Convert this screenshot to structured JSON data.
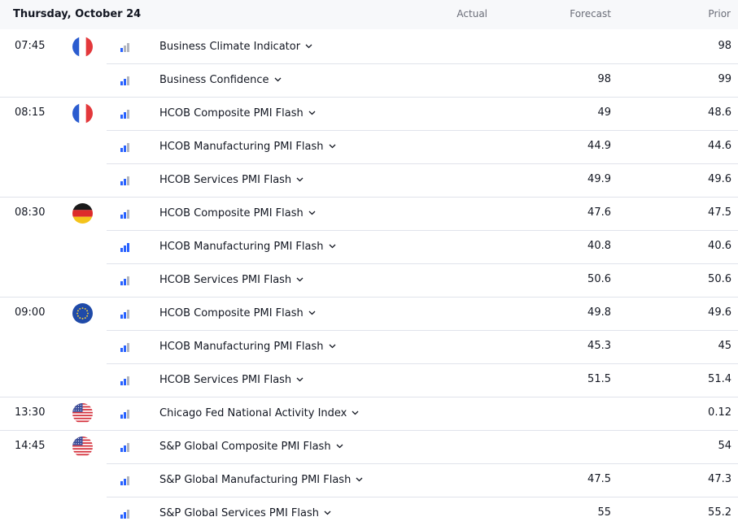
{
  "header": {
    "date": "Thursday, October 24",
    "actual_label": "Actual",
    "forecast_label": "Forecast",
    "prior_label": "Prior"
  },
  "colors": {
    "bar_active": "#2962ff",
    "bar_inactive": "#b2b5be"
  },
  "rows": [
    {
      "time": "07:45",
      "flag": "france-flag-icon",
      "importance": 1,
      "name": "Business Climate Indicator",
      "actual": "",
      "forecast": "",
      "prior": "98"
    },
    {
      "time": "",
      "flag": "",
      "importance": 2,
      "name": "Business Confidence",
      "actual": "",
      "forecast": "98",
      "prior": "99"
    },
    {
      "time": "08:15",
      "flag": "france-flag-icon",
      "importance": 2,
      "name": "HCOB Composite PMI Flash",
      "actual": "",
      "forecast": "49",
      "prior": "48.6"
    },
    {
      "time": "",
      "flag": "",
      "importance": 2,
      "name": "HCOB Manufacturing PMI Flash",
      "actual": "",
      "forecast": "44.9",
      "prior": "44.6"
    },
    {
      "time": "",
      "flag": "",
      "importance": 2,
      "name": "HCOB Services PMI Flash",
      "actual": "",
      "forecast": "49.9",
      "prior": "49.6"
    },
    {
      "time": "08:30",
      "flag": "germany-flag-icon",
      "importance": 2,
      "name": "HCOB Composite PMI Flash",
      "actual": "",
      "forecast": "47.6",
      "prior": "47.5"
    },
    {
      "time": "",
      "flag": "",
      "importance": 3,
      "name": "HCOB Manufacturing PMI Flash",
      "actual": "",
      "forecast": "40.8",
      "prior": "40.6"
    },
    {
      "time": "",
      "flag": "",
      "importance": 2,
      "name": "HCOB Services PMI Flash",
      "actual": "",
      "forecast": "50.6",
      "prior": "50.6"
    },
    {
      "time": "09:00",
      "flag": "eu-flag-icon",
      "importance": 2,
      "name": "HCOB Composite PMI Flash",
      "actual": "",
      "forecast": "49.8",
      "prior": "49.6"
    },
    {
      "time": "",
      "flag": "",
      "importance": 2,
      "name": "HCOB Manufacturing PMI Flash",
      "actual": "",
      "forecast": "45.3",
      "prior": "45"
    },
    {
      "time": "",
      "flag": "",
      "importance": 2,
      "name": "HCOB Services PMI Flash",
      "actual": "",
      "forecast": "51.5",
      "prior": "51.4"
    },
    {
      "time": "13:30",
      "flag": "usa-flag-icon",
      "importance": 2,
      "name": "Chicago Fed National Activity Index",
      "actual": "",
      "forecast": "",
      "prior": "0.12"
    },
    {
      "time": "14:45",
      "flag": "usa-flag-icon",
      "importance": 2,
      "name": "S&P Global Composite PMI Flash",
      "actual": "",
      "forecast": "",
      "prior": "54"
    },
    {
      "time": "",
      "flag": "",
      "importance": 2,
      "name": "S&P Global Manufacturing PMI Flash",
      "actual": "",
      "forecast": "47.5",
      "prior": "47.3"
    },
    {
      "time": "",
      "flag": "",
      "importance": 2,
      "name": "S&P Global Services PMI Flash",
      "actual": "",
      "forecast": "55",
      "prior": "55.2"
    }
  ]
}
